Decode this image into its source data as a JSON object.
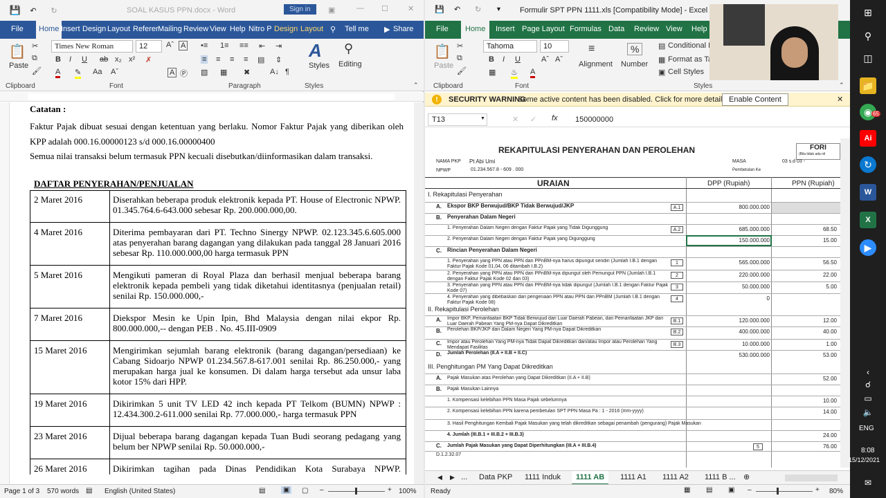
{
  "word": {
    "title": "SOAL KASUS PPN.docx - Word",
    "signin": "Sign in",
    "tabs": [
      "File",
      "Home",
      "Insert",
      "Design",
      "Layout",
      "Referer",
      "Mailing",
      "Review",
      "View",
      "Help",
      "Nitro P",
      "Design",
      "Layout",
      "Tell me",
      "Share"
    ],
    "font": "Times New Roman",
    "size": "12",
    "paste": "Paste",
    "styles": "Styles",
    "editing": "Editing",
    "groups": [
      "Clipboard",
      "Font",
      "Paragraph",
      "Styles"
    ],
    "catatan": "Catatan :",
    "para1": "Faktur Pajak dibuat sesuai dengan ketentuan yang berlaku. Nomor Faktur Pajak yang diberikan oleh KPP adalah 000.16.00000123 s/d 000.16.00000400",
    "para2": "Semua nilai transaksi belum termasuk PPN kecuali disebutkan/diinformasikan dalam transaksi.",
    "heading": "DAFTAR PENYERAHAN/PENJUALAN",
    "rows": [
      {
        "date": "2 Maret 2016",
        "text": "Diserahkan beberapa produk elektronik kepada PT. House of Electronic NPWP. 01.345.764.6-643.000 sebesar Rp. 200.000.000,00."
      },
      {
        "date": "4 Maret 2016",
        "text": "Diterima pembayaran dari PT. Techno Sinergy NPWP. 02.123.345.6.605.000 atas penyerahan barang dagangan yang dilakukan pada tanggal 28 Januari 2016 sebesar Rp. 110.000.000,00 harga termasuk PPN"
      },
      {
        "date": "5 Maret 2016",
        "text": "Mengikuti pameran di Royal Plaza dan berhasil menjual beberapa barang elektronik kepada pembeli yang tidak diketahui identitasnya (penjualan retail) senilai Rp. 150.000.000,-"
      },
      {
        "date": "7 Maret 2016",
        "text": "Diekspor Mesin ke Upin Ipin, Bhd Malaysia dengan nilai ekpor Rp. 800.000.000,-- dengan PEB . No. 45.III-0909"
      },
      {
        "date": "15 Maret 2016",
        "text": "Mengirimkan sejumlah barang elektronik (barang dagangan/persediaan) ke Cabang Sidoarjo NPWP 01.234.567.8-617.001 senilai Rp. 86.250.000,- yang merupakan harga jual ke konsumen. Di dalam harga tersebut ada unsur laba kotor 15% dari HPP."
      },
      {
        "date": "19 Maret 2016",
        "text": "Dikirimkan 5 unit TV LED 42 inch kepada PT Telkom (BUMN) NPWP : 12.434.300.2-611.000 senilai Rp. 77.000.000,- harga termasuk PPN"
      },
      {
        "date": "23 Maret 2016",
        "text": "Dijual beberapa barang dagangan kepada Tuan Budi seorang pedagang yang belum ber NPWP senilai Rp. 50.000.000,-"
      },
      {
        "date": "26 Maret 2016",
        "text": "Dikirimkan tagihan pada Dinas Pendidikan Kota Surabaya NPWP. 00.000.345.3-614.000 atas penyerahaan beberapa barang elektronik pada"
      }
    ],
    "status": {
      "page": "Page 1 of 3",
      "words": "570 words",
      "lang": "English (United States)",
      "zoom": "100%"
    }
  },
  "excel": {
    "title": "Formulir SPT PPN 1111.xls [Compatibility Mode] - Excel",
    "tabs": [
      "File",
      "Home",
      "Insert",
      "Page Layout",
      "Formulas",
      "Data",
      "Review",
      "View",
      "Help"
    ],
    "font": "Tahoma",
    "size": "10",
    "paste": "Paste",
    "alignment": "Alignment",
    "number": "Number",
    "cond": "Conditional F",
    "formatas": "Format as Ta",
    "cellstyles": "Cell Styles",
    "groups": [
      "Clipboard",
      "Font",
      "Styles"
    ],
    "warning_label": "SECURITY WARNING",
    "warning_text": "Some active content has been disabled. Click for more details.",
    "enable": "Enable Content",
    "cellref": "T13",
    "formula": "150000000",
    "sheet": {
      "title": "REKAPITULASI PENYERAHAN DAN PEROLEHAN",
      "form": "FORI",
      "form_note": "(Bila tidak ada nil",
      "nama_label": "NAMA PKP",
      "nama": "Pt Abi Umi",
      "npwp_label": "NPWP",
      "npwp": "01.234.567.8  -  609  .  000",
      "masa_label": "MASA",
      "masa": "03   s.d  03   -",
      "pemb": "Pembetulan Ke",
      "uraian": "URAIAN",
      "dpp": "DPP (Rupiah)",
      "ppn": "PPN (Rupiah)",
      "s1": "I. Rekapitulasi Penyerahan",
      "rows": [
        {
          "k": "A.",
          "t": "Ekspor BKP Berwujud/BKP Tidak Berwujud/JKP",
          "code": "A.1",
          "dpp": "800.000.000",
          "ppn": ""
        },
        {
          "k": "B.",
          "t": "Penyerahan Dalam Negeri",
          "code": "",
          "dpp": "",
          "ppn": ""
        },
        {
          "k": "",
          "t": "1. Penyerahan Dalam Negeri dengan Faktur Pajak yang Tidak Digunggung",
          "code": "A.2",
          "dpp": "685.000.000",
          "ppn": "68.50"
        },
        {
          "k": "",
          "t": "2. Penyerahan Dalam Negeri dengan Faktur Pajak yang Digunggung",
          "code": "",
          "dpp": "150.000.000",
          "ppn": "15.00"
        },
        {
          "k": "C.",
          "t": "Rincian Penyerahan Dalam Negeri",
          "code": "",
          "dpp": "",
          "ppn": ""
        },
        {
          "k": "",
          "t": "1. Penyerahan yang PPN atau PPN dan PPnBM-nya harus dipungut sendiri (Jumlah I.B.1 dengan Faktur Pajak Kode 01,04, 06 ditambah I.B.2)",
          "code": "1",
          "dpp": "565.000.000",
          "ppn": "56.50"
        },
        {
          "k": "",
          "t": "2. Penyerahan yang PPN atau PPN dan PPnBM-nya dipungut oleh Pemungut PPN (Jumlah I.B.1 dengan Faktur Pajak Kode 02 dan 03)",
          "code": "2",
          "dpp": "220.000.000",
          "ppn": "22.00"
        },
        {
          "k": "",
          "t": "3. Penyerahan yang PPN atau PPN dan PPnBM-nya tidak dipungut (Jumlah I.B.1 dengan Faktur Pajak Kode 07)",
          "code": "3",
          "dpp": "50.000.000",
          "ppn": "5.00"
        },
        {
          "k": "",
          "t": "4. Penyerahan yang dibebaskan dari pengenaan PPN atau PPN dan PPnBM (Jumlah I.B.1 dengan Faktur Pajak Kode 08)",
          "code": "4",
          "dpp": "0",
          "ppn": ""
        }
      ],
      "s2": "II. Rekapitulasi Perolehan",
      "rows2": [
        {
          "k": "A.",
          "t": "Impor BKP, Pemanfaatan BKP Tidak Berwujud dari Luar Daerah Pabean, dan Pemanfaatan JKP dari Luar Daerah Pabean Yang PM-nya Dapat Dikreditkan",
          "code": "B.1",
          "dpp": "120.000.000",
          "ppn": "12.00"
        },
        {
          "k": "B.",
          "t": "Perolehan BKP/JKP dari Dalam Negeri Yang PM-nya Dapat Dikreditkan",
          "code": "B.2",
          "dpp": "400.000.000",
          "ppn": "40.00"
        },
        {
          "k": "C.",
          "t": "Impor atau Perolehan Yang PM-nya Tidak Dapat Dikreditkan dan/atau Impor atau Perolehan Yang Mendapat Fasilitas",
          "code": "B.3",
          "dpp": "10.000.000",
          "ppn": "1.00"
        },
        {
          "k": "D.",
          "t": "Jumlah Perolehan (II.A + II.B + II.C)",
          "code": "",
          "dpp": "530.000.000",
          "ppn": "53.00"
        }
      ],
      "s3": "III. Penghitungan PM Yang Dapat Dikreditkan",
      "rows3": [
        {
          "k": "A.",
          "t": "Pajak Masukan atas Perolehan yang Dapat Dikreditkan (II.A + II.B)",
          "ppn": "52.00"
        },
        {
          "k": "B.",
          "t": "Pajak Masukan Lainnya",
          "ppn": ""
        },
        {
          "k": "",
          "t": "1. Kompensasi kelebihan PPN Masa Pajak sebelumnya",
          "ppn": "10.00"
        },
        {
          "k": "",
          "t": "2. Kompensasi kelebihan PPN karena pembetulan SPT PPN Masa Pa :   1   -   2016   (mm-yyyy)",
          "ppn": "14.00"
        },
        {
          "k": "",
          "t": "3. Hasil Penghitungan Kembali Pajak Masukan yang telah dikreditkan sebagai penambah (pengurang) Pajak Masukan",
          "ppn": ""
        },
        {
          "k": "",
          "t": "4. Jumlah (III.B.1 + III.B.2 + III.B.3)",
          "ppn": "24.00"
        },
        {
          "k": "C.",
          "t": "Jumlah Pajak Masukan yang Dapat Diperhitungkan (III.A + III.B.4)",
          "ppn": "76.00"
        }
      ],
      "footer": "D.1.2.32.07"
    },
    "sheet_tabs": [
      "...",
      "Data PKP",
      "1111 Induk",
      "1111 AB",
      "1111 A1",
      "1111 A2",
      "1111 B ..."
    ],
    "status": {
      "ready": "Ready",
      "zoom": "80%"
    }
  },
  "taskbar": {
    "lang": "ENG",
    "time": "8:08",
    "date": "15/12/2021",
    "badge": "65"
  }
}
